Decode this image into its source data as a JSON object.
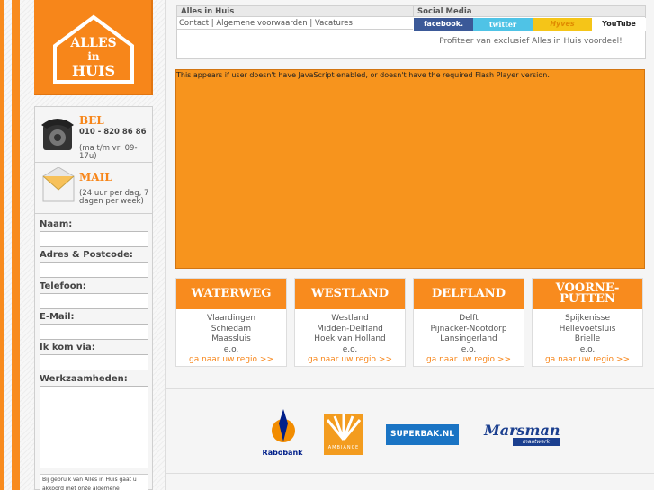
{
  "logo": {
    "line1": "ALLES",
    "line2": "in",
    "line3": "HUIS"
  },
  "contact": {
    "bel_heading": "BEL",
    "phone": "010 - 820 86 86",
    "phone_hours": "(ma t/m vr: 09-17u)",
    "mail_heading": "MAIL",
    "mail_note": "(24 uur per dag, 7 dagen per week)"
  },
  "form": {
    "name_label": "Naam:",
    "address_label": "Adres & Postcode:",
    "phone_label": "Telefoon:",
    "email_label": "E-Mail:",
    "via_label": "Ik kom via:",
    "work_label": "Werkzaamheden:",
    "footer_note": "Bij gebruik van Alles in Huis gaat u akkoord met onze algemene"
  },
  "top": {
    "company_heading": "Alles in Huis",
    "links": [
      "Contact",
      "Algemene voorwaarden",
      "Vacatures"
    ],
    "separator": " | ",
    "social_heading": "Social Media",
    "social": [
      {
        "label": "facebook.",
        "color": "#3b5998"
      },
      {
        "label": "twitter",
        "color": "#4fc3e6"
      },
      {
        "label": "Hyves",
        "color": "#f5c518"
      },
      {
        "label": "YouTube",
        "color": "#ffffff"
      }
    ],
    "promo": "Profiteer van exclusief Alles in Huis voordeel!"
  },
  "flash_message": "This appears if user doesn't have JavaScript enabled, or doesn't have the required Flash Player version.",
  "regions": [
    {
      "title": "WATERWEG",
      "towns": [
        "Vlaardingen",
        "Schiedam",
        "Maassluis",
        "e.o."
      ],
      "link": "ga naar uw regio >>"
    },
    {
      "title": "WESTLAND",
      "towns": [
        "Westland",
        "Midden-Delfland",
        "Hoek van Holland",
        "e.o."
      ],
      "link": "ga naar uw regio >>"
    },
    {
      "title": "DELFLAND",
      "towns": [
        "Delft",
        "Pijnacker-Nootdorp",
        "Lansingerland",
        "e.o."
      ],
      "link": "ga naar uw regio >>"
    },
    {
      "title": "VOORNE-PUTTEN",
      "towns": [
        "Spijkenisse",
        "Hellevoetsluis",
        "Brielle",
        "e.o."
      ],
      "link": "ga naar uw regio >>"
    }
  ],
  "partners": {
    "rabobank": "Rabobank",
    "ambiance": "AMBIANCE",
    "superbak": "SUPERBAK.NL",
    "marsman": "Marsman",
    "marsman_sub": "maatwerk"
  },
  "colors": {
    "brand_orange": "#f7861a"
  }
}
